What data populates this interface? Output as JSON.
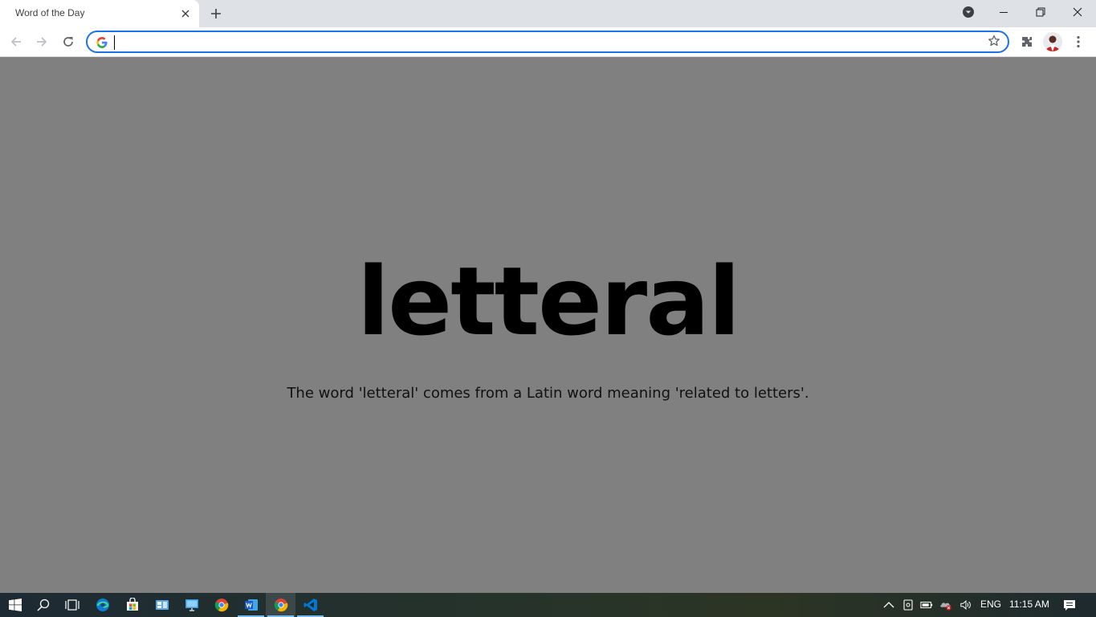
{
  "browser": {
    "tab_title": "Word of the Day",
    "address_value": "",
    "colors": {
      "omnibox_focus": "#1a73e8",
      "tabstrip_bg": "#dee1e6"
    }
  },
  "page": {
    "word": "letteral",
    "description": "The word 'letteral' comes from a Latin word meaning 'related to letters'.",
    "background": "#808080"
  },
  "taskbar": {
    "apps": [
      "start-icon",
      "search-icon",
      "task-view-icon",
      "edge-icon",
      "store-icon",
      "outlook-icon",
      "remote-desktop-icon",
      "chrome-icon",
      "word-icon",
      "chrome-active-icon",
      "vscode-icon"
    ],
    "tray": {
      "language": "ENG",
      "time": "11:15 AM"
    }
  }
}
